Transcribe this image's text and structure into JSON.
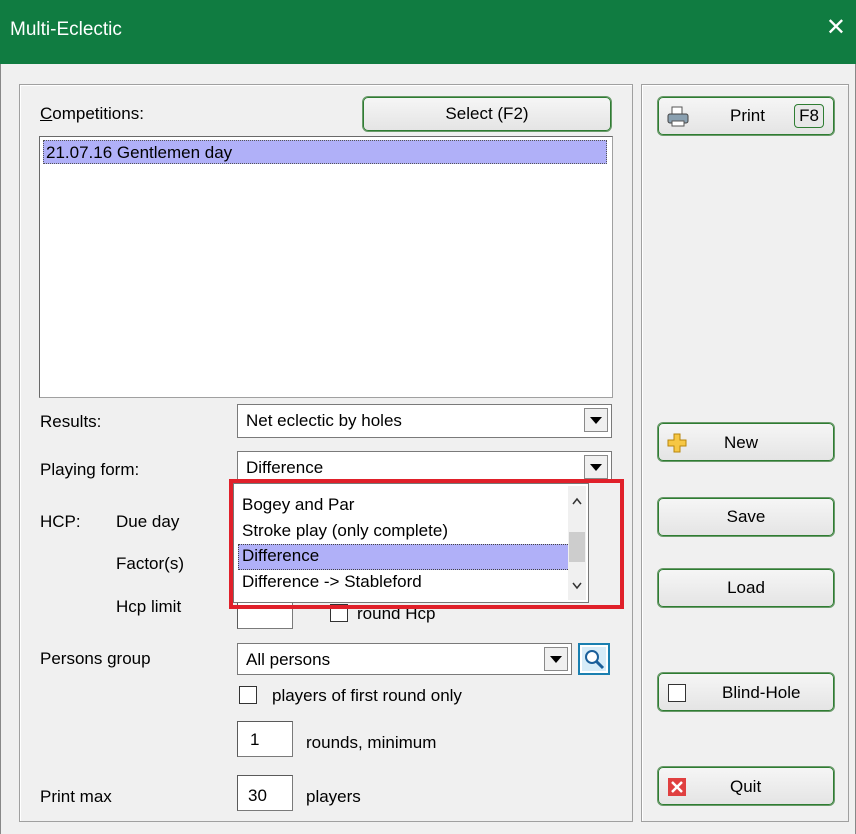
{
  "window": {
    "title": "Multi-Eclectic",
    "close_glyph": "✕"
  },
  "competitions": {
    "label": "Competitions:",
    "select_button": "Select (F2)",
    "items": [
      "21.07.16 Gentlemen day"
    ]
  },
  "results": {
    "label": "Results:",
    "value": "Net eclectic by holes"
  },
  "playing_form": {
    "label": "Playing form:",
    "value": "Difference",
    "options": [
      "Bogey and Par",
      "Stroke play (only complete)",
      "Difference",
      "Difference -> Stableford"
    ],
    "selected_index": 2
  },
  "hcp": {
    "label": "HCP:",
    "due_day_label": "Due day",
    "factors_label": "Factor(s)",
    "hcp_limit_label": "Hcp limit",
    "round_hcp_label": "round Hcp"
  },
  "persons_group": {
    "label": "Persons group",
    "value": "All persons"
  },
  "players_first_round": {
    "label": "players of first round only",
    "checked": false
  },
  "rounds_minimum": {
    "value": "1",
    "label": "rounds, minimum"
  },
  "print_max": {
    "label": "Print max",
    "value": "30",
    "unit_label": "players"
  },
  "sidebar": {
    "print_button": "Print",
    "print_shortcut": "F8",
    "new_button": "New",
    "save_button": "Save",
    "load_button": "Load",
    "blind_hole_button": "Blind-Hole",
    "quit_button": "Quit"
  },
  "colors": {
    "titlebar": "#107c41",
    "selection": "#b0b0f8",
    "highlight_box": "#e0202a"
  }
}
